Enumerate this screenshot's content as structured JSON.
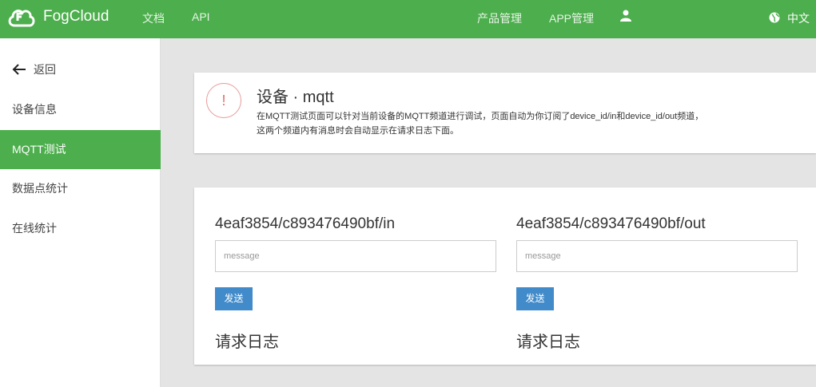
{
  "header": {
    "brand": "FogCloud",
    "nav": [
      "文档",
      "API"
    ],
    "right_nav": [
      "产品管理",
      "APP管理"
    ],
    "lang": "中文",
    "brand_color": "#4cae4c"
  },
  "sidebar": {
    "back_label": "返回",
    "items": [
      {
        "label": "设备信息"
      },
      {
        "label": "MQTT测试"
      },
      {
        "label": "数据点统计"
      },
      {
        "label": "在线统计"
      }
    ],
    "active_index": 1
  },
  "info_card": {
    "icon_glyph": "!",
    "title": "设备 · mqtt",
    "desc_line1": "在MQTT测试页面可以针对当前设备的MQTT频道进行调试，页面自动为你订阅了device_id/in和device_id/out频道，",
    "desc_line2": "这两个频道内有消息时会自动显示在请求日志下面。"
  },
  "channels": [
    {
      "topic": "4eaf3854/c893476490bf/in",
      "placeholder": "message",
      "send_label": "发送",
      "log_title": "请求日志"
    },
    {
      "topic": "4eaf3854/c893476490bf/out",
      "placeholder": "message",
      "send_label": "发送",
      "log_title": "请求日志"
    }
  ]
}
